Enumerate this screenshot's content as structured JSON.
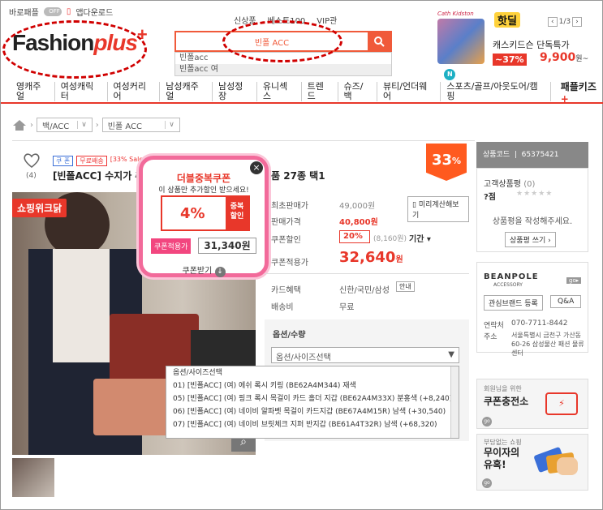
{
  "topbar": {
    "shortcut": "바로패플",
    "toggle": "OFF",
    "app_download": "앱다운로드"
  },
  "logo": {
    "word": "Fashion",
    "plus": "plus"
  },
  "toplinks": [
    "신상품",
    "베스트100",
    "VIP관"
  ],
  "search": {
    "value": "빈폴 ACC",
    "suggestions": [
      "빈폴acc",
      "빈폴acc 여"
    ]
  },
  "ad": {
    "brand_small": "Cath Kidston",
    "hot_label": "핫딜",
    "title": "캐스키드슨 단독특가",
    "discount": "~37%",
    "price": "9,900",
    "price_unit": "원~",
    "pager": "1/3"
  },
  "nav": [
    "영캐주얼",
    "여성캐릭터",
    "여성커리어",
    "남성캐주얼",
    "남성정장",
    "유니섹스",
    "트렌드",
    "슈즈/백",
    "뷰티/언더웨어",
    "스포츠/골프/아웃도어/캠핑",
    "패플키즈"
  ],
  "nav_new_badge": "N",
  "breadcrumb": [
    "백/ACC",
    "빈폴 ACC"
  ],
  "product": {
    "like_count": "(4)",
    "tag1": "쿠 폰",
    "tag2": "무료배송",
    "tag3": "[33% Sale]",
    "title": "[빈폴ACC] 수지가 추",
    "title_rest": "상품 27종 택1",
    "discount_badge": "33",
    "discount_unit": "%",
    "shop_badge": "쇼핑위크닭"
  },
  "coupon": {
    "title": "더블중복쿠폰",
    "subtitle": "이 상품만 추가할인 받으세요!",
    "pct": "4%",
    "side": "중복\n할인",
    "label": "쿠폰적용가",
    "value": "31,340원",
    "get": "쿠폰받기"
  },
  "price_info": {
    "rows": [
      {
        "label": "최초판매가",
        "value": "49,000원"
      },
      {
        "label": "판매가격",
        "value": "40,800원"
      },
      {
        "label": "쿠폰할인",
        "value": "20%"
      },
      {
        "label": "쿠폰적용가",
        "value": "32,640"
      },
      {
        "label": "카드혜택",
        "value": "신한/국민/삼성"
      },
      {
        "label": "배송비",
        "value": "무료"
      }
    ],
    "coupon_detail": "(8,160원)",
    "period": "기간",
    "calc_btn": "미리계산해보기",
    "price_unit": "원",
    "card_info_btn": "안내"
  },
  "options": {
    "heading": "옵션/수량",
    "select": "옵션/사이즈선택",
    "list": [
      "옵션/사이즈선택",
      "01) [빈폴ACC] (여) 에쉬 록시 키링 (BE62A4M344) 재색",
      "05) [빈폴ACC] (여) 핑크 록시 목걸이 카드 홀더 지갑 (BE62A4M33X) 분홍색 (+8,240)",
      "06) [빈폴ACC] (여) 네이비 알파벳 목걸이 카드지갑 (BE67A4M15R) 남색 (+30,540)",
      "07) [빈폴ACC] (여) 네이비 브릿체크 지퍼 반지갑 (BE61A4T32R) 남색 (+68,320)"
    ]
  },
  "side": {
    "code_label": "상품코드",
    "code_value": "65375421",
    "review_label": "고객상품평",
    "review_count": "(0)",
    "score": "?점",
    "review_prompt": "상품평을 작성해주세요.",
    "review_btn": "상품평 쓰기",
    "brand": "BEANPOLE",
    "brand_sub": "ACCESSORY",
    "go": "go",
    "interest_btn": "관심브랜드 등록",
    "qa_btn": "Q&A",
    "contact_label": "연락처",
    "contact_value": "070-7711-8442",
    "address_label": "주소",
    "address_value": "서울특별시 금천구 가산동 60-26 삼성물산 패션 물류센터",
    "promo1_small": "회원님을 위한",
    "promo1_big": "쿠폰충전소",
    "promo2_small": "부담없는 쇼핑",
    "promo2_big": "무이자의 유혹!"
  },
  "colors": {
    "accent": "#e8372a",
    "search": "#f05a3a",
    "badge": "#ff5a1f",
    "coupon_pink": "#f26a9a"
  }
}
